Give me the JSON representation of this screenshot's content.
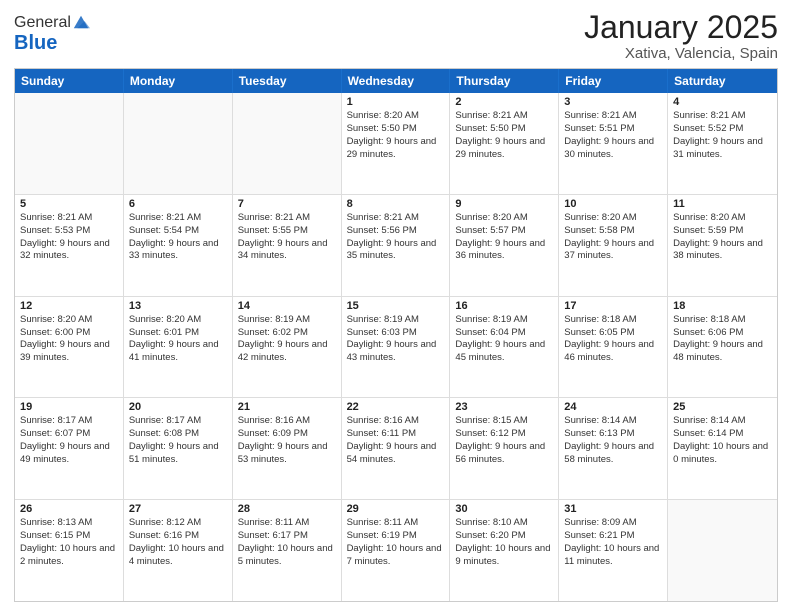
{
  "logo": {
    "general": "General",
    "blue": "Blue"
  },
  "title": "January 2025",
  "subtitle": "Xativa, Valencia, Spain",
  "header_days": [
    "Sunday",
    "Monday",
    "Tuesday",
    "Wednesday",
    "Thursday",
    "Friday",
    "Saturday"
  ],
  "weeks": [
    [
      {
        "day": "",
        "text": ""
      },
      {
        "day": "",
        "text": ""
      },
      {
        "day": "",
        "text": ""
      },
      {
        "day": "1",
        "text": "Sunrise: 8:20 AM\nSunset: 5:50 PM\nDaylight: 9 hours and 29 minutes."
      },
      {
        "day": "2",
        "text": "Sunrise: 8:21 AM\nSunset: 5:50 PM\nDaylight: 9 hours and 29 minutes."
      },
      {
        "day": "3",
        "text": "Sunrise: 8:21 AM\nSunset: 5:51 PM\nDaylight: 9 hours and 30 minutes."
      },
      {
        "day": "4",
        "text": "Sunrise: 8:21 AM\nSunset: 5:52 PM\nDaylight: 9 hours and 31 minutes."
      }
    ],
    [
      {
        "day": "5",
        "text": "Sunrise: 8:21 AM\nSunset: 5:53 PM\nDaylight: 9 hours and 32 minutes."
      },
      {
        "day": "6",
        "text": "Sunrise: 8:21 AM\nSunset: 5:54 PM\nDaylight: 9 hours and 33 minutes."
      },
      {
        "day": "7",
        "text": "Sunrise: 8:21 AM\nSunset: 5:55 PM\nDaylight: 9 hours and 34 minutes."
      },
      {
        "day": "8",
        "text": "Sunrise: 8:21 AM\nSunset: 5:56 PM\nDaylight: 9 hours and 35 minutes."
      },
      {
        "day": "9",
        "text": "Sunrise: 8:20 AM\nSunset: 5:57 PM\nDaylight: 9 hours and 36 minutes."
      },
      {
        "day": "10",
        "text": "Sunrise: 8:20 AM\nSunset: 5:58 PM\nDaylight: 9 hours and 37 minutes."
      },
      {
        "day": "11",
        "text": "Sunrise: 8:20 AM\nSunset: 5:59 PM\nDaylight: 9 hours and 38 minutes."
      }
    ],
    [
      {
        "day": "12",
        "text": "Sunrise: 8:20 AM\nSunset: 6:00 PM\nDaylight: 9 hours and 39 minutes."
      },
      {
        "day": "13",
        "text": "Sunrise: 8:20 AM\nSunset: 6:01 PM\nDaylight: 9 hours and 41 minutes."
      },
      {
        "day": "14",
        "text": "Sunrise: 8:19 AM\nSunset: 6:02 PM\nDaylight: 9 hours and 42 minutes."
      },
      {
        "day": "15",
        "text": "Sunrise: 8:19 AM\nSunset: 6:03 PM\nDaylight: 9 hours and 43 minutes."
      },
      {
        "day": "16",
        "text": "Sunrise: 8:19 AM\nSunset: 6:04 PM\nDaylight: 9 hours and 45 minutes."
      },
      {
        "day": "17",
        "text": "Sunrise: 8:18 AM\nSunset: 6:05 PM\nDaylight: 9 hours and 46 minutes."
      },
      {
        "day": "18",
        "text": "Sunrise: 8:18 AM\nSunset: 6:06 PM\nDaylight: 9 hours and 48 minutes."
      }
    ],
    [
      {
        "day": "19",
        "text": "Sunrise: 8:17 AM\nSunset: 6:07 PM\nDaylight: 9 hours and 49 minutes."
      },
      {
        "day": "20",
        "text": "Sunrise: 8:17 AM\nSunset: 6:08 PM\nDaylight: 9 hours and 51 minutes."
      },
      {
        "day": "21",
        "text": "Sunrise: 8:16 AM\nSunset: 6:09 PM\nDaylight: 9 hours and 53 minutes."
      },
      {
        "day": "22",
        "text": "Sunrise: 8:16 AM\nSunset: 6:11 PM\nDaylight: 9 hours and 54 minutes."
      },
      {
        "day": "23",
        "text": "Sunrise: 8:15 AM\nSunset: 6:12 PM\nDaylight: 9 hours and 56 minutes."
      },
      {
        "day": "24",
        "text": "Sunrise: 8:14 AM\nSunset: 6:13 PM\nDaylight: 9 hours and 58 minutes."
      },
      {
        "day": "25",
        "text": "Sunrise: 8:14 AM\nSunset: 6:14 PM\nDaylight: 10 hours and 0 minutes."
      }
    ],
    [
      {
        "day": "26",
        "text": "Sunrise: 8:13 AM\nSunset: 6:15 PM\nDaylight: 10 hours and 2 minutes."
      },
      {
        "day": "27",
        "text": "Sunrise: 8:12 AM\nSunset: 6:16 PM\nDaylight: 10 hours and 4 minutes."
      },
      {
        "day": "28",
        "text": "Sunrise: 8:11 AM\nSunset: 6:17 PM\nDaylight: 10 hours and 5 minutes."
      },
      {
        "day": "29",
        "text": "Sunrise: 8:11 AM\nSunset: 6:19 PM\nDaylight: 10 hours and 7 minutes."
      },
      {
        "day": "30",
        "text": "Sunrise: 8:10 AM\nSunset: 6:20 PM\nDaylight: 10 hours and 9 minutes."
      },
      {
        "day": "31",
        "text": "Sunrise: 8:09 AM\nSunset: 6:21 PM\nDaylight: 10 hours and 11 minutes."
      },
      {
        "day": "",
        "text": ""
      }
    ]
  ]
}
